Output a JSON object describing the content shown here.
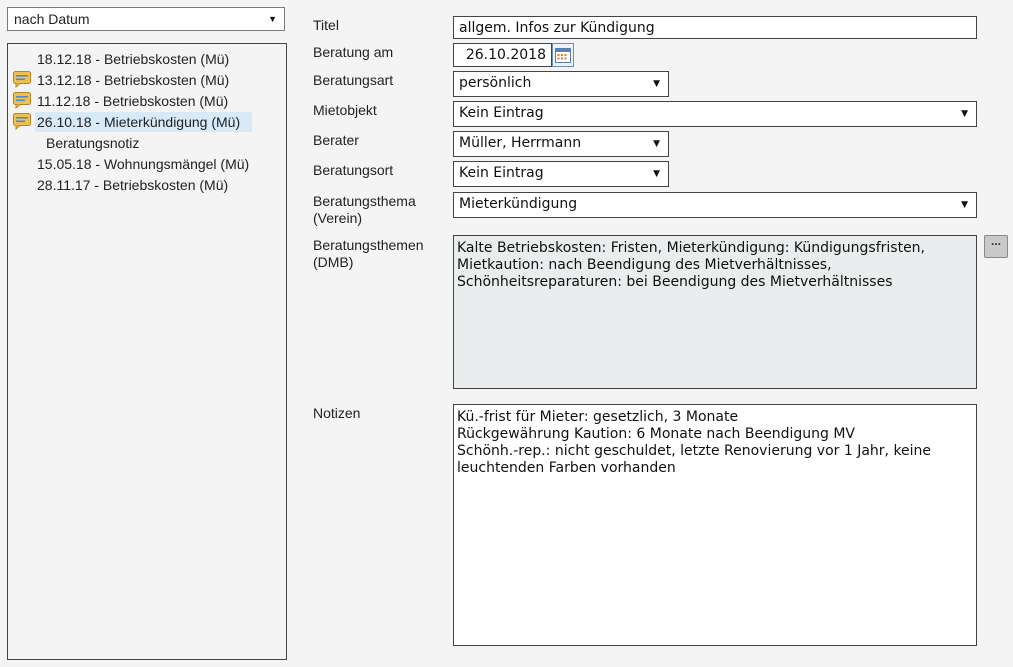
{
  "sort": {
    "selected": "nach Datum"
  },
  "tree": {
    "items": [
      {
        "label": "18.12.18 - Betriebskosten (Mü)",
        "has_note": false
      },
      {
        "label": "13.12.18 - Betriebskosten (Mü)",
        "has_note": true
      },
      {
        "label": "11.12.18 - Betriebskosten (Mü)",
        "has_note": true
      },
      {
        "label": "26.10.18 - Mieterkündigung (Mü)",
        "has_note": true,
        "selected": true
      },
      {
        "label": "15.05.18 - Wohnungsmängel (Mü)",
        "has_note": false
      },
      {
        "label": "28.11.17 - Betriebskosten (Mü)",
        "has_note": false
      }
    ],
    "child_label": "Beratungsnotiz"
  },
  "form": {
    "titel_label": "Titel",
    "titel_value": "allgem. Infos zur Kündigung",
    "datum_label": "Beratung am",
    "datum_value": "26.10.2018",
    "art_label": "Beratungsart",
    "art_value": "persönlich",
    "mietobjekt_label": "Mietobjekt",
    "mietobjekt_value": "Kein Eintrag",
    "berater_label": "Berater",
    "berater_value": "Müller, Herrmann",
    "ort_label": "Beratungsort",
    "ort_value": "Kein Eintrag",
    "thema_verein_label": "Beratungsthema (Verein)",
    "thema_verein_value": "Mieterkündigung",
    "themen_dmb_label": "Beratungsthemen (DMB)",
    "themen_dmb_value": "Kalte Betriebskosten: Fristen, Mieterkündigung: Kündigungsfristen,\nMietkaution: nach Beendigung des Mietverhältnisses,\nSchönheitsreparaturen: bei Beendigung des Mietverhältnisses",
    "themen_dmb_button": "...",
    "notizen_label": "Notizen",
    "notizen_value": "Kü.-frist für Mieter: gesetzlich, 3 Monate\nRückgewährung Kaution: 6 Monate nach Beendigung MV\nSchönh.-rep.: nicht geschuldet, letzte Renovierung vor 1 Jahr, keine\nleuchtenden Farben vorhanden"
  },
  "icons": {
    "note_icon": "note-icon",
    "calendar_icon": "calendar-icon",
    "dropdown_icon": "caret-down-icon"
  }
}
